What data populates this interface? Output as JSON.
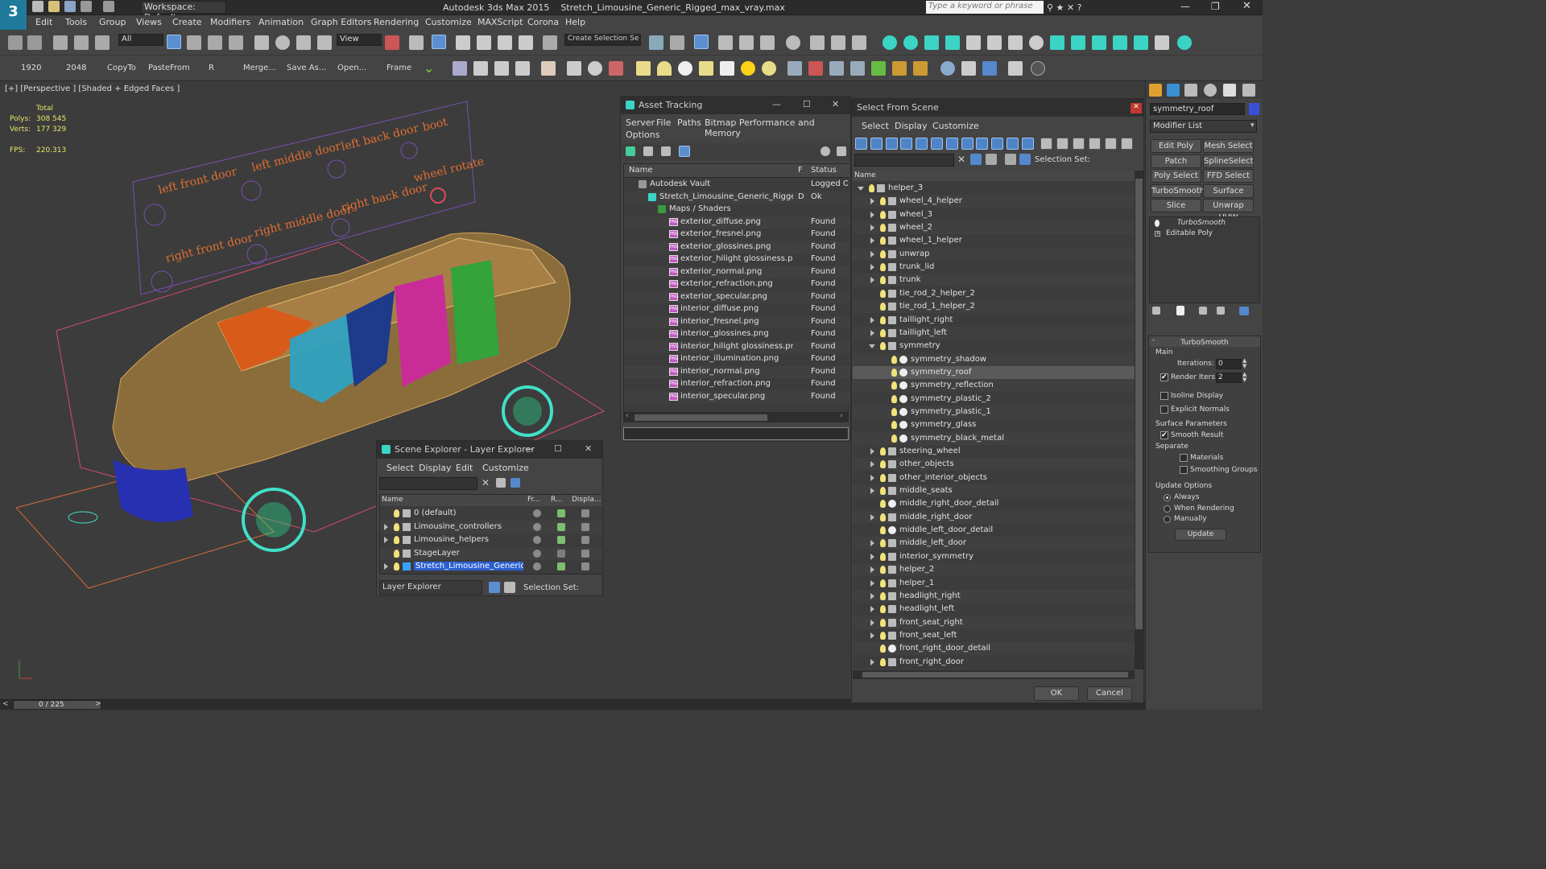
{
  "app": {
    "title": "Autodesk 3ds Max  2015",
    "file": "Stretch_Limousine_Generic_Rigged_max_vray.max",
    "workspace": "Workspace: Default",
    "search_placeholder": "Type a keyword or phrase"
  },
  "menus": [
    "Edit",
    "Tools",
    "Group",
    "Views",
    "Create",
    "Modifiers",
    "Animation",
    "Graph Editors",
    "Rendering",
    "Customize",
    "MAXScript",
    "Corona",
    "Help"
  ],
  "toolbar1": {
    "filter": "All",
    "view": "View",
    "create_selection": "Create Selection Se"
  },
  "toolbar2": {
    "labels": [
      "1920",
      "2048",
      "CopyTo",
      "PasteFrom",
      "R",
      "Merge...",
      "Save As...",
      "Open...",
      "Frame"
    ]
  },
  "viewport": {
    "label": "[+] [Perspective ] [Shaded + Edged Faces ]",
    "stats": {
      "total": "Total",
      "polys_label": "Polys:",
      "polys": "308 545",
      "verts_label": "Verts:",
      "verts": "177 329",
      "fps_label": "FPS:",
      "fps": "220.313"
    },
    "rig_labels": [
      "left front door",
      "left middle door",
      "left back door",
      "boot",
      "right front door",
      "right middle door",
      "right back door",
      "wheel rotate"
    ]
  },
  "asset_tracking": {
    "title": "Asset Tracking",
    "menu": [
      "Server",
      "File",
      "Paths",
      "Bitmap Performance and Memory",
      "Options"
    ],
    "columns": [
      "Name",
      "F",
      "Status"
    ],
    "rows": [
      {
        "name": "Autodesk Vault",
        "f": "",
        "status": "Logged Out"
      },
      {
        "name": "Stretch_Limousine_Generic_Rigged_...",
        "f": "D",
        "status": "Ok"
      },
      {
        "name": "Maps / Shaders",
        "f": "",
        "status": ""
      },
      {
        "name": "exterior_diffuse.png",
        "f": "",
        "status": "Found"
      },
      {
        "name": "exterior_fresnel.png",
        "f": "",
        "status": "Found"
      },
      {
        "name": "exterior_glossines.png",
        "f": "",
        "status": "Found"
      },
      {
        "name": "exterior_hilight glossiness.png",
        "f": "",
        "status": "Found"
      },
      {
        "name": "exterior_normal.png",
        "f": "",
        "status": "Found"
      },
      {
        "name": "exterior_refraction.png",
        "f": "",
        "status": "Found"
      },
      {
        "name": "exterior_specular.png",
        "f": "",
        "status": "Found"
      },
      {
        "name": "interior_diffuse.png",
        "f": "",
        "status": "Found"
      },
      {
        "name": "interior_fresnel.png",
        "f": "",
        "status": "Found"
      },
      {
        "name": "interior_glossines.png",
        "f": "",
        "status": "Found"
      },
      {
        "name": "interior_hilight glossiness.png",
        "f": "",
        "status": "Found"
      },
      {
        "name": "interior_illumination.png",
        "f": "",
        "status": "Found"
      },
      {
        "name": "interior_normal.png",
        "f": "",
        "status": "Found"
      },
      {
        "name": "interior_refraction.png",
        "f": "",
        "status": "Found"
      },
      {
        "name": "interior_specular.png",
        "f": "",
        "status": "Found"
      }
    ]
  },
  "layer_explorer": {
    "title": "Scene Explorer - Layer Explorer",
    "menu": [
      "Select",
      "Display",
      "Edit",
      "Customize"
    ],
    "columns": [
      "Name",
      "Fr...",
      "R...",
      "Displa..."
    ],
    "rows": [
      "0 (default)",
      "Limousine_controllers",
      "Limousine_helpers",
      "StageLayer",
      "Stretch_Limousine_Generic_Rig..."
    ],
    "footer_mode": "Layer Explorer",
    "selection_set": "Selection Set:"
  },
  "select_from_scene": {
    "title": "Select From Scene",
    "menu": [
      "Select",
      "Display",
      "Customize"
    ],
    "selection_set": "Selection Set:",
    "column": "Name",
    "rows": [
      "helper_3",
      "wheel_4_helper",
      "wheel_3",
      "wheel_2",
      "wheel_1_helper",
      "unwrap",
      "trunk_lid",
      "trunk",
      "tie_rod_2_helper_2",
      "tie_rod_1_helper_2",
      "taillight_right",
      "taillight_left",
      "symmetry",
      "symmetry_shadow",
      "symmetry_roof",
      "symmetry_reflection",
      "symmetry_plastic_2",
      "symmetry_plastic_1",
      "symmetry_glass",
      "symmetry_black_metal",
      "steering_wheel",
      "other_objects",
      "other_interior_objects",
      "middle_seats",
      "middle_right_door_detail",
      "middle_right_door",
      "middle_left_door_detail",
      "middle_left_door",
      "interior_symmetry",
      "helper_2",
      "helper_1",
      "headlight_right",
      "headlight_left",
      "front_seat_right",
      "front_seat_left",
      "front_right_door_detail",
      "front_right_door"
    ],
    "ok": "OK",
    "cancel": "Cancel"
  },
  "command_panel": {
    "object_name": "symmetry_roof",
    "modifier_list": "Modifier List",
    "buttons": [
      "Edit Poly",
      "Mesh Select",
      "Patch Select",
      "SplineSelect",
      "Poly Select",
      "FFD Select",
      "TurboSmooth",
      "Surface Select",
      "Slice",
      "Unwrap UVW"
    ],
    "stack": [
      "TurboSmooth",
      "Editable Poly"
    ],
    "rollout_title": "TurboSmooth",
    "main": "Main",
    "iterations_label": "Iterations:",
    "iterations": "0",
    "render_iters_label": "Render Iters:",
    "render_iters": "2",
    "isoline": "Isoline Display",
    "explicit_normals": "Explicit Normals",
    "surface_params": "Surface Parameters",
    "smooth_result": "Smooth Result",
    "separate": "Separate",
    "materials": "Materials",
    "smoothing_groups": "Smoothing Groups",
    "update_options": "Update Options",
    "always": "Always",
    "when_rendering": "When Rendering",
    "manually": "Manually",
    "update": "Update"
  },
  "timeline": {
    "frame": "0 / 225"
  }
}
